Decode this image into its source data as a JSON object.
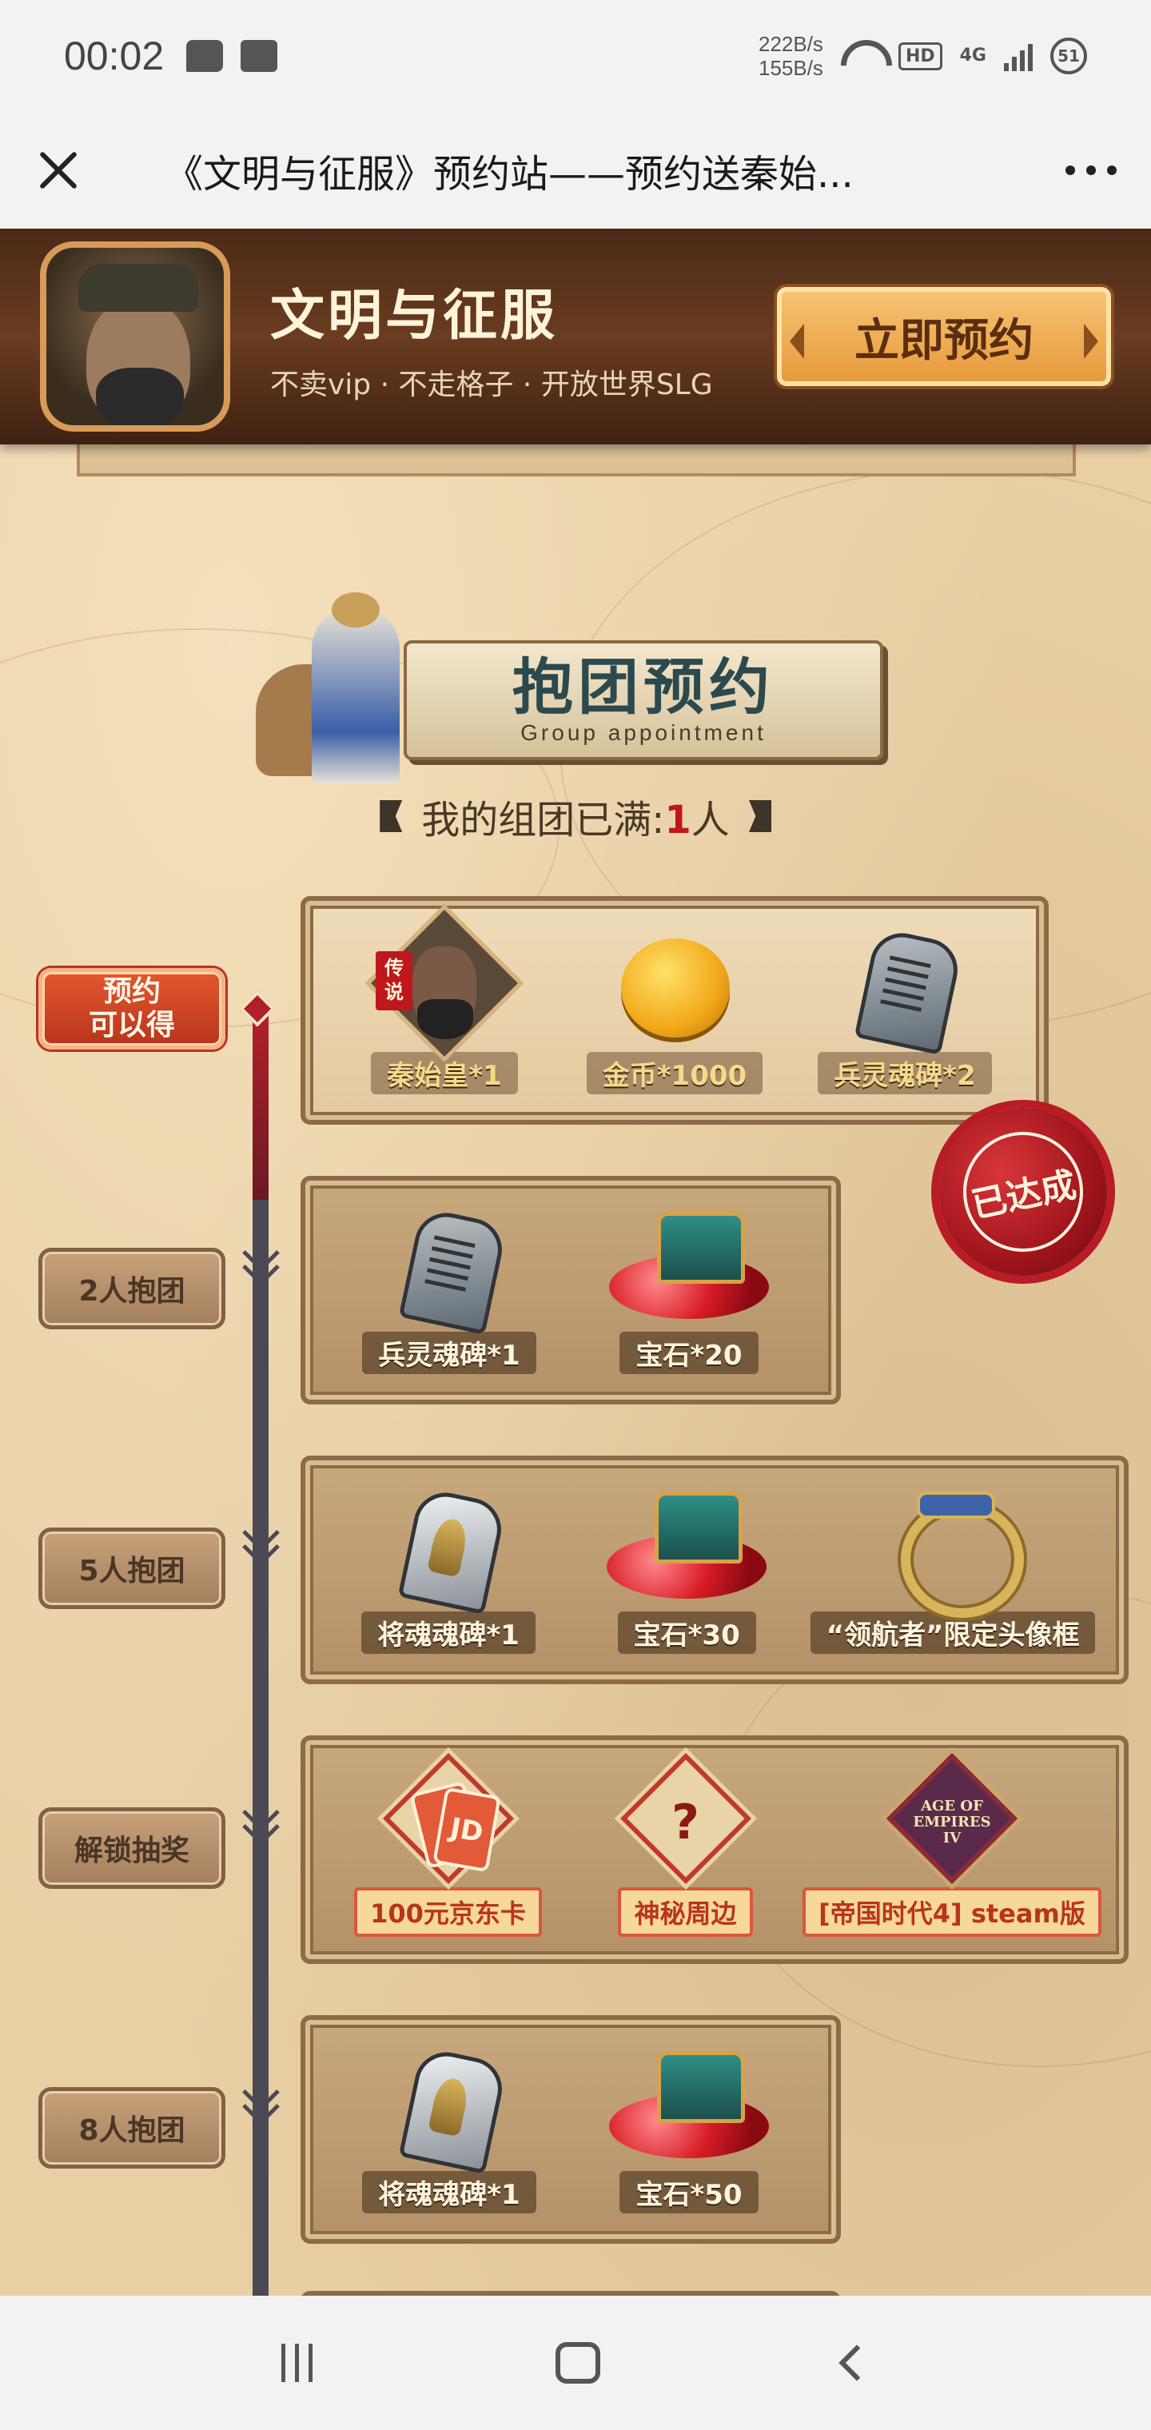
{
  "status_bar": {
    "time": "00:02",
    "net_up": "222B/s",
    "net_down": "155B/s",
    "hd": "HD",
    "network": "4G",
    "battery": "51"
  },
  "title_bar": {
    "title": "《文明与征服》预约站——预约送秦始..."
  },
  "banner": {
    "game_name": "文明与征服",
    "tagline": "不卖vip · 不走格子 · 开放世界SLG",
    "reserve_label": "立即预约"
  },
  "section": {
    "title": "抱团预约",
    "subtitle": "Group appointment",
    "status_prefix": "我的组团已满:",
    "status_count": "1",
    "status_suffix": "人"
  },
  "tiers": [
    {
      "label_line1": "预约",
      "label_line2": "可以得",
      "achieved": "已达成",
      "items": [
        {
          "icon": "hero-portrait-icon",
          "caption": "秦始皇*1",
          "badge": "传说"
        },
        {
          "icon": "gold-coin-icon",
          "caption": "金币*1000"
        },
        {
          "icon": "soldier-stele-icon",
          "caption": "兵灵魂碑*2"
        }
      ]
    },
    {
      "label": "2人抱团",
      "items": [
        {
          "icon": "soldier-stele-icon",
          "caption": "兵灵魂碑*1"
        },
        {
          "icon": "gem-chest-icon",
          "caption": "宝石*20"
        }
      ]
    },
    {
      "label": "5人抱团",
      "items": [
        {
          "icon": "general-stele-icon",
          "caption": "将魂魂碑*1"
        },
        {
          "icon": "gem-chest-icon",
          "caption": "宝石*30"
        },
        {
          "icon": "avatar-frame-icon",
          "caption": "“领航者”限定头像框"
        }
      ]
    },
    {
      "label": "解锁抽奖",
      "items": [
        {
          "icon": "jd-card-icon",
          "caption": "100元京东卡",
          "card_text": "JD"
        },
        {
          "icon": "mystery-icon",
          "caption": "神秘周边",
          "glyph": "?"
        },
        {
          "icon": "aoe4-icon",
          "caption": "[帝国时代4] steam版",
          "logo_text": "AGE OF EMPIRES IV"
        }
      ]
    },
    {
      "label": "8人抱团",
      "items": [
        {
          "icon": "general-stele-icon",
          "caption": "将魂魂碑*1"
        },
        {
          "icon": "gem-chest-icon",
          "caption": "宝石*50"
        }
      ]
    }
  ],
  "colors": {
    "accent_red": "#c0171c",
    "banner_brown": "#4a2a16",
    "button_orange": "#e89a3c",
    "parchment": "#e8cfa4"
  }
}
